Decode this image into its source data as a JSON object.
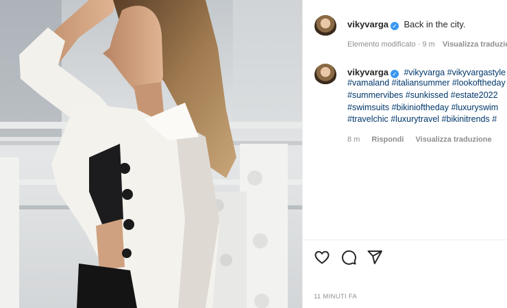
{
  "post": {
    "author": "vikyvarga",
    "caption": "Back in the city.",
    "caption_meta": {
      "edited": "Elemento modificato",
      "age": "9 m",
      "translate": "Visualizza traduzione"
    }
  },
  "comment": {
    "author": "vikyvarga",
    "lines": [
      "#vikyvarga #vikyvargastyle",
      "#vamaland #italiansummer #lookoftheday",
      "#summervibes #sunkissed #estate2022",
      "#swimsuits #bikinioftheday #luxuryswim",
      "#travelchic #luxurytravel #bikinitrends #"
    ],
    "meta": {
      "age": "8 m",
      "reply": "Rispondi",
      "translate": "Visualizza traduzione"
    }
  },
  "actions": {
    "like_icon": "heart-icon",
    "comment_icon": "comment-icon",
    "share_icon": "share-icon"
  },
  "timestamp": "11 MINUTI FA",
  "colors": {
    "hashtag": "#00376b",
    "verified": "#3897f0",
    "meta": "#8e8e8e"
  }
}
